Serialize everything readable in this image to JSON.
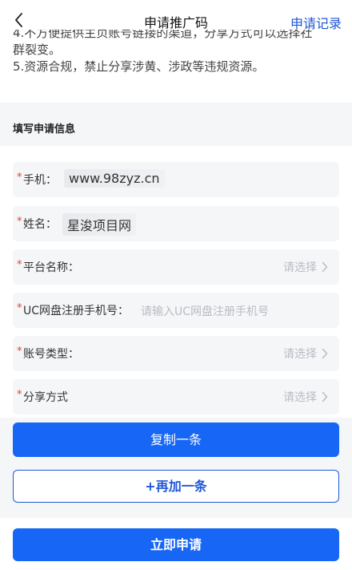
{
  "header": {
    "title": "申请推广码",
    "records_link": "申请记录"
  },
  "notice": {
    "lines": [
      "4.不方便提供主页账号链接的渠道，分享方式可以选择社",
      "群裂变。",
      "5.资源合规，禁止分享涉黄、涉政等违规资源。"
    ]
  },
  "section": {
    "title": "填写申请信息"
  },
  "form": {
    "phone": {
      "label": "手机：",
      "value": "www.98zyz.cn"
    },
    "name": {
      "label": "姓名：",
      "value": "星浚项目网"
    },
    "platform": {
      "label": "平台名称：",
      "placeholder": "请选择"
    },
    "uc_phone": {
      "label": "UC网盘注册手机号：",
      "placeholder": "请输入UC网盘注册手机号"
    },
    "account_type": {
      "label": "账号类型：",
      "placeholder": "请选择"
    },
    "share_method": {
      "label": "分享方式",
      "placeholder": "请选择"
    },
    "required_mark": "*"
  },
  "actions": {
    "copy_label": "复制一条",
    "add_label": "+再加一条",
    "submit_label": "立即申请"
  },
  "colors": {
    "primary": "#1766f5",
    "link": "#1f57d6",
    "required": "#e0413b",
    "placeholder": "#b8bcc3"
  }
}
